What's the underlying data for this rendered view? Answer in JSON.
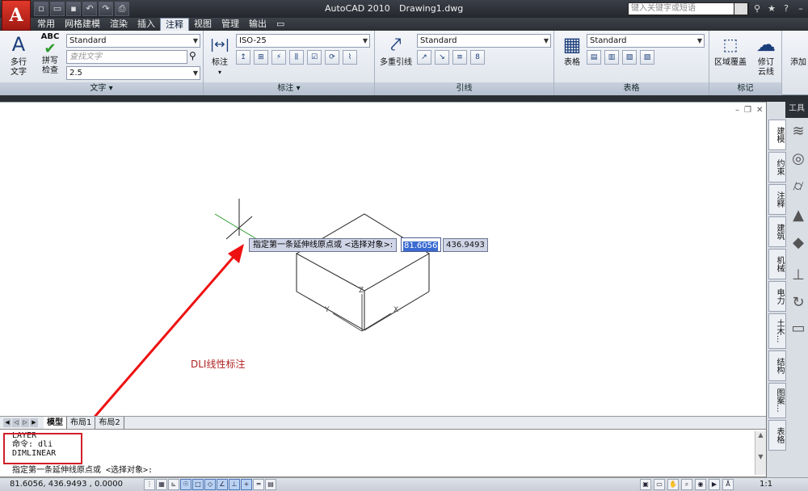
{
  "titlebar": {
    "app": "AutoCAD 2010",
    "document": "Drawing1.dwg",
    "search_placeholder": "键入关键字或短语",
    "logo": "A",
    "qat_icons": [
      "new-icon",
      "open-icon",
      "save-icon",
      "undo-icon",
      "redo-icon",
      "plot-icon"
    ]
  },
  "ribbon": {
    "tabs": [
      "常用",
      "网格建模",
      "渲染",
      "插入",
      "注释",
      "视图",
      "管理",
      "输出"
    ],
    "active_tab": "注释",
    "panels": {
      "text": {
        "title": "文字",
        "multiline_label": "多行\n文字",
        "spell_label": "拼写\n检查",
        "abc": "ABC",
        "style_value": "Standard",
        "find_placeholder": "查找文字",
        "height_value": "2.5"
      },
      "dimension": {
        "title": "标注",
        "big_label": "标注",
        "style_value": "ISO-25"
      },
      "leader": {
        "title": "引线",
        "big_label": "多重引线",
        "style_value": "Standard"
      },
      "table": {
        "title": "表格",
        "big_label": "表格",
        "style_value": "Standard"
      },
      "markup": {
        "title": "标记",
        "wipeout_label": "区域覆盖",
        "revcloud_label": "修订\n云线",
        "add_label": "添加"
      }
    }
  },
  "drawing": {
    "dynamic_prompt": "指定第一条延伸线原点或 <选择对象>:",
    "dyn_x": "81.6056",
    "dyn_y": "436.9493",
    "annotation": "DLI线性标注",
    "axis_labels": [
      "Z",
      "Y",
      "X"
    ]
  },
  "palette": {
    "title": "工具",
    "tabs": [
      "建模",
      "约束",
      "注释",
      "建筑",
      "机械",
      "电力",
      "土木...",
      "结构",
      "图案...",
      "表格"
    ]
  },
  "layout": {
    "tabs": [
      "模型",
      "布局1",
      "布局2"
    ],
    "active": "模型"
  },
  "command": {
    "history": [
      "LAYER",
      "命令: dli",
      "DIMLINEAR"
    ],
    "prompt": "指定第一条延伸线原点或 <选择对象>:"
  },
  "status": {
    "coords": "81.6056, 436.9493 , 0.0000",
    "scale": "1:1"
  },
  "colors": {
    "accent_red": "#d0202a",
    "annotation": "#b22222",
    "selection": "#3a6bd0"
  }
}
